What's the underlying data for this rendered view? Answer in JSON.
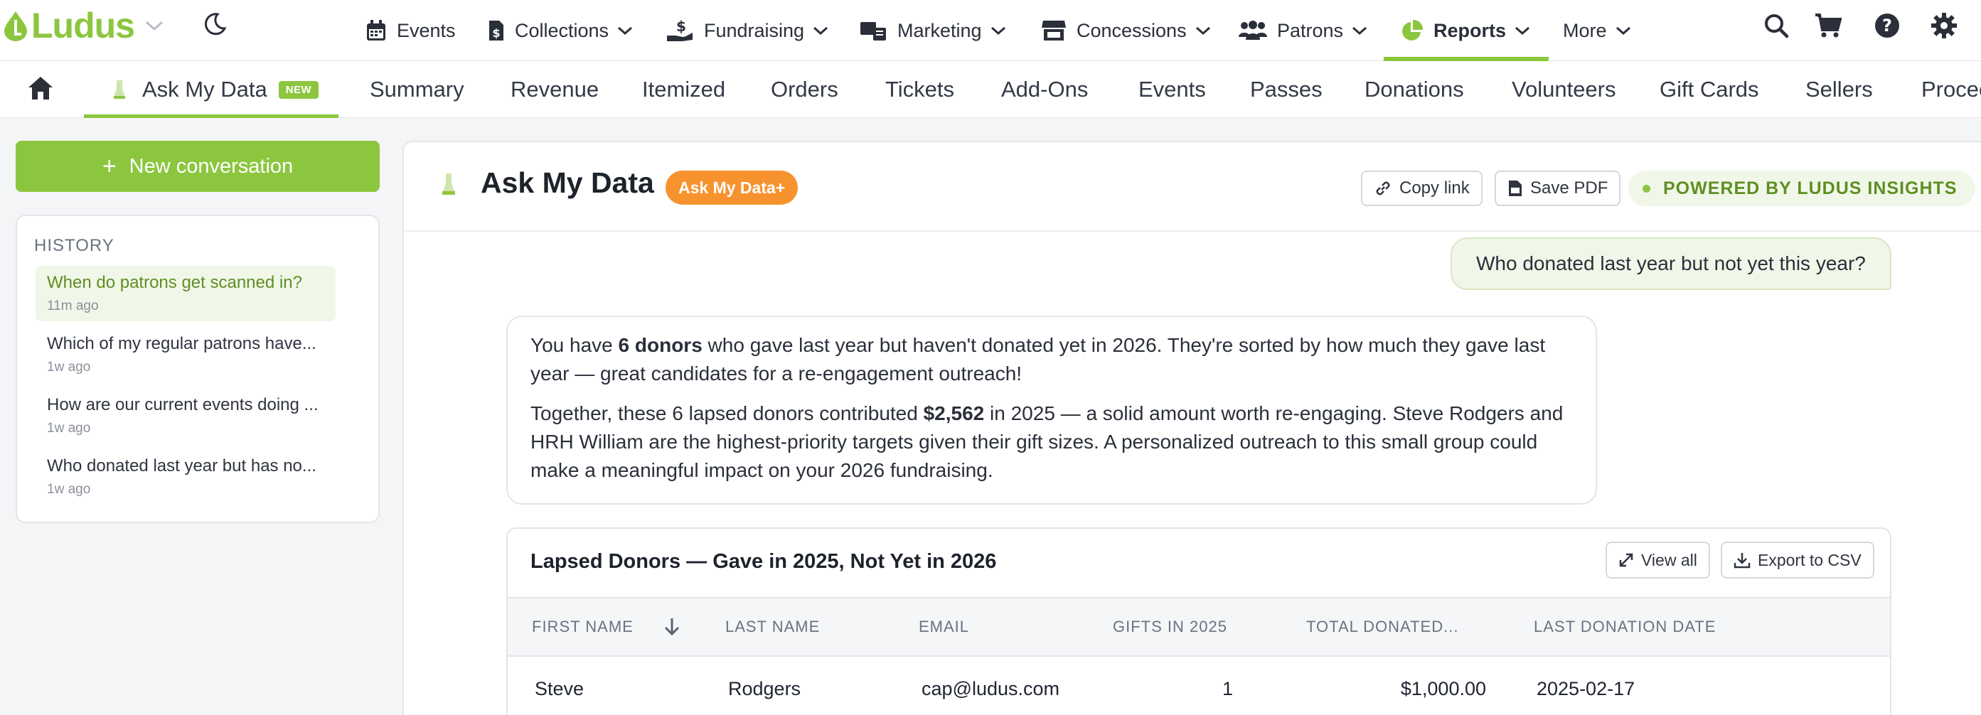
{
  "brand": {
    "name": "Ludus",
    "accent": "#8cc63f",
    "orange": "#f7932f"
  },
  "topnav": {
    "items": [
      {
        "label": "Events",
        "icon": "calendar-icon",
        "dropdown": false
      },
      {
        "label": "Collections",
        "icon": "document-dollar-icon",
        "dropdown": true
      },
      {
        "label": "Fundraising",
        "icon": "hand-dollar-icon",
        "dropdown": true
      },
      {
        "label": "Marketing",
        "icon": "megaphone-icon",
        "dropdown": true
      },
      {
        "label": "Concessions",
        "icon": "store-icon",
        "dropdown": true
      },
      {
        "label": "Patrons",
        "icon": "users-icon",
        "dropdown": true
      },
      {
        "label": "Reports",
        "icon": "pie-chart-icon",
        "dropdown": true,
        "active": true
      },
      {
        "label": "More",
        "icon": "",
        "dropdown": true
      }
    ],
    "right_icons": [
      "search-icon",
      "cart-icon",
      "help-icon",
      "gear-icon"
    ]
  },
  "subnav": {
    "tabs": [
      "Ask My Data",
      "Summary",
      "Revenue",
      "Itemized",
      "Orders",
      "Tickets",
      "Add-Ons",
      "Events",
      "Passes",
      "Donations",
      "Volunteers",
      "Gift Cards",
      "Sellers",
      "Procee"
    ],
    "active": "Ask My Data",
    "new_badge": "NEW"
  },
  "sidebar": {
    "new_conversation": "New conversation",
    "history_title": "HISTORY",
    "history": [
      {
        "question": "When do patrons get scanned in?",
        "time": "11m ago",
        "selected": true
      },
      {
        "question": "Which of my regular patrons have...",
        "time": "1w ago"
      },
      {
        "question": "How are our current events doing ...",
        "time": "1w ago"
      },
      {
        "question": "Who donated last year but has no...",
        "time": "1w ago"
      }
    ]
  },
  "main": {
    "title": "Ask My Data",
    "plus_badge": "Ask My Data+",
    "copy_link": "Copy link",
    "save_pdf": "Save PDF",
    "powered_by": "POWERED BY LUDUS INSIGHTS",
    "user_question": "Who donated last year but not yet this year?",
    "answer": {
      "p1_pre": "You have ",
      "p1_bold": "6 donors",
      "p1_post": " who gave last year but haven't donated yet in 2026. They're sorted by how much they gave last year — great candidates for a re-engagement outreach!",
      "p2_pre": "Together, these 6 lapsed donors contributed ",
      "p2_bold": "$2,562",
      "p2_post": " in 2025 — a solid amount worth re-engaging. Steve Rodgers and HRH William are the highest-priority targets given their gift sizes. A personalized outreach to this small group could make a meaningful impact on your 2026 fundraising."
    },
    "table": {
      "title": "Lapsed Donors — Gave in 2025, Not Yet in 2026",
      "view_all": "View all",
      "export": "Export to CSV",
      "columns": [
        "FIRST NAME",
        "LAST NAME",
        "EMAIL",
        "GIFTS IN 2025",
        "TOTAL DONATED...",
        "LAST DONATION DATE"
      ],
      "rows": [
        [
          "Steve",
          "Rodgers",
          "cap@ludus.com",
          "1",
          "$1,000.00",
          "2025-02-17"
        ]
      ]
    }
  }
}
